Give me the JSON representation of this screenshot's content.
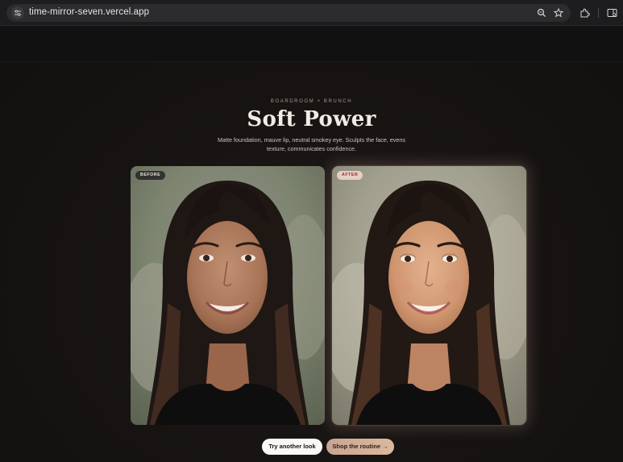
{
  "browser": {
    "url": "time-mirror-seven.vercel.app",
    "icons": [
      "site-settings-icon",
      "zoom-icon",
      "bookmark-star-icon",
      "extensions-icon",
      "side-panel-icon"
    ]
  },
  "hero": {
    "eyebrow": "BOARDROOM + BRUNCH",
    "title": "Soft Power",
    "description": "Matte foundation, mauve lip, neutral smokey eye. Sculpts the face, evens texture, communicates confidence."
  },
  "comparison": {
    "before_label": "BEFORE",
    "after_label": "AFTER"
  },
  "actions": {
    "secondary_label": "Try another look",
    "primary_label": "Shop the routine →"
  },
  "colors": {
    "background": "#151313",
    "accent": "#d3ae98",
    "after_badge_text": "#8a2f2c"
  }
}
